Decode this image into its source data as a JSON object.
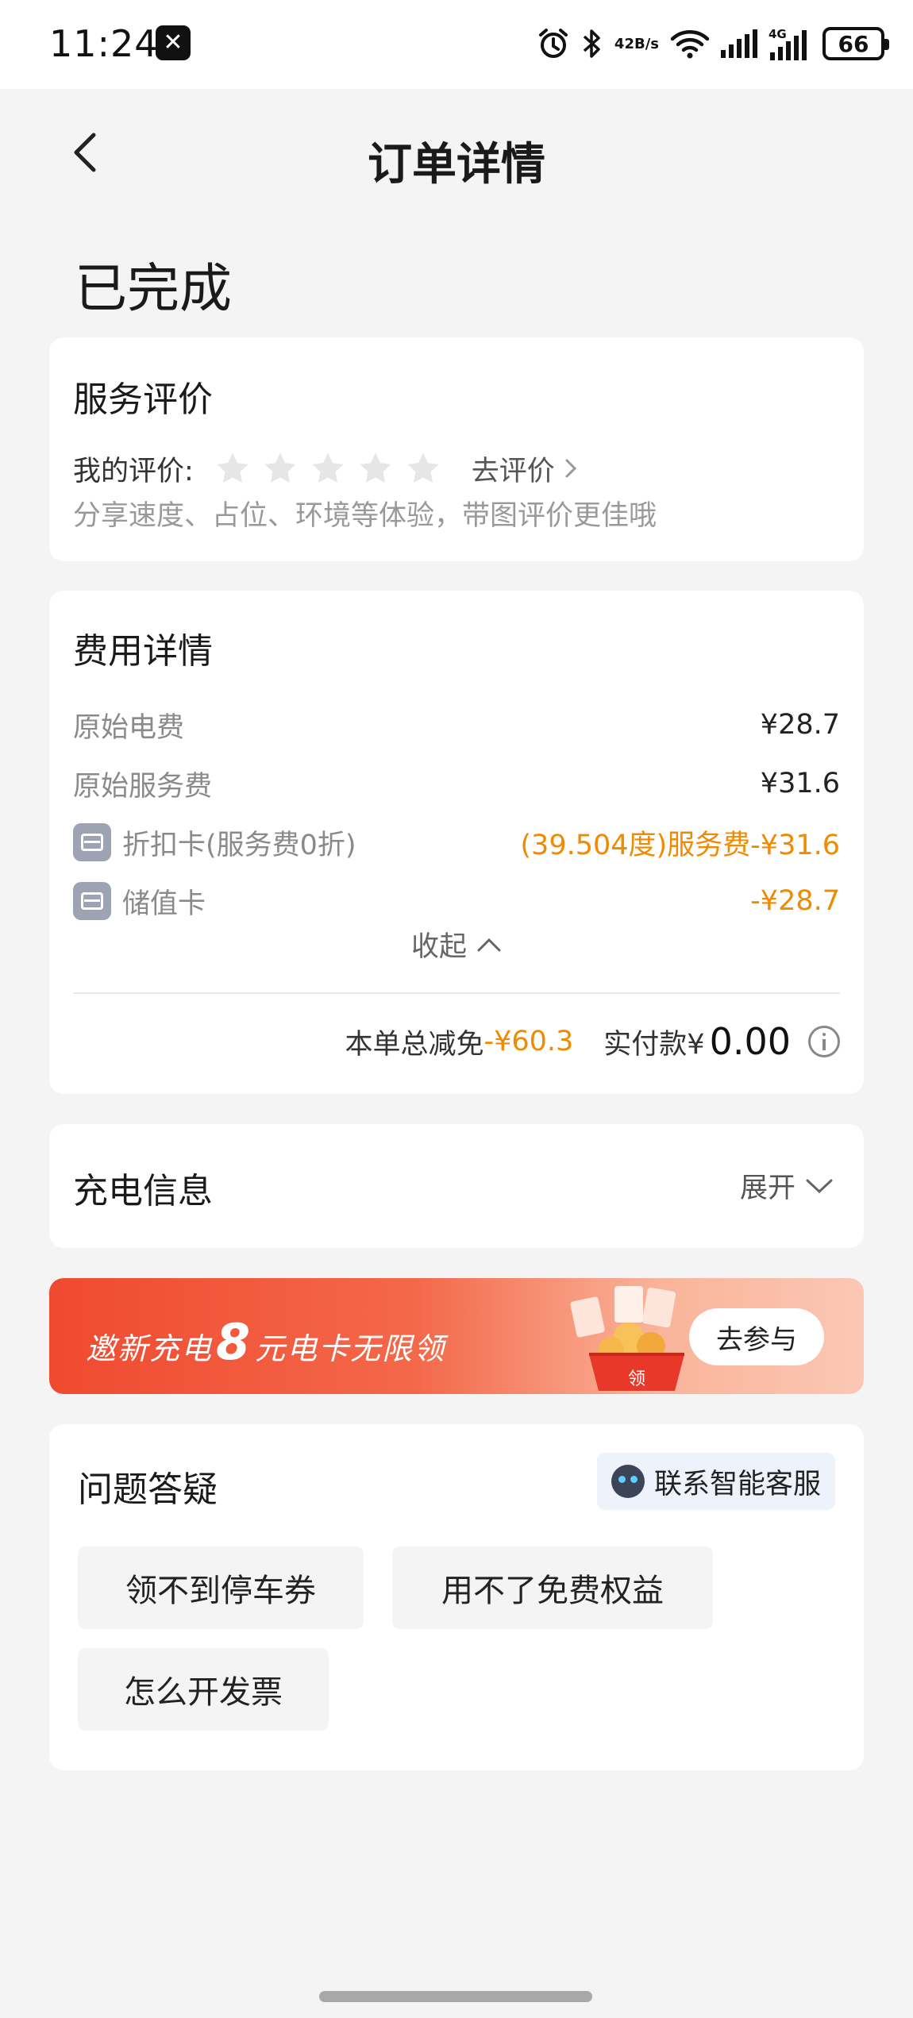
{
  "status_bar": {
    "time": "11:24",
    "net_speed_top": "42",
    "net_speed_bottom": "B/s",
    "network_type": "4G",
    "battery": "66"
  },
  "header": {
    "title": "订单详情"
  },
  "order_status": "已完成",
  "rating_card": {
    "title": "服务评价",
    "my_rating_label": "我的评价:",
    "go_rate": "去评价",
    "hint": "分享速度、占位、环境等体验，带图评价更佳哦",
    "stars_filled": 0,
    "stars_total": 5
  },
  "fee_card": {
    "title": "费用详情",
    "rows": [
      {
        "label": "原始电费",
        "value": "¥28.7"
      },
      {
        "label": "原始服务费",
        "value": "¥31.6"
      },
      {
        "label": "折扣卡(服务费0折)",
        "value": "(39.504度)服务费-¥31.6"
      },
      {
        "label": "储值卡",
        "value": "-¥28.7"
      }
    ],
    "collapse": "收起",
    "total_discount_label": "本单总减免",
    "total_discount_value": "-¥60.3",
    "paid_label": "实付款¥",
    "paid_value": "0.00"
  },
  "charge_card": {
    "title": "充电信息",
    "expand": "展开"
  },
  "banner": {
    "text_prefix": "邀新充电",
    "text_number": "8",
    "text_suffix": "元电卡无限领",
    "button": "去参与",
    "gift_text": "领"
  },
  "qa_card": {
    "title": "问题答疑",
    "cs_button": "联系智能客服",
    "chips": [
      "领不到停车券",
      "用不了免费权益",
      "怎么开发票"
    ]
  },
  "colors": {
    "accent_orange": "#f08a00",
    "banner_red": "#ef4a30"
  }
}
